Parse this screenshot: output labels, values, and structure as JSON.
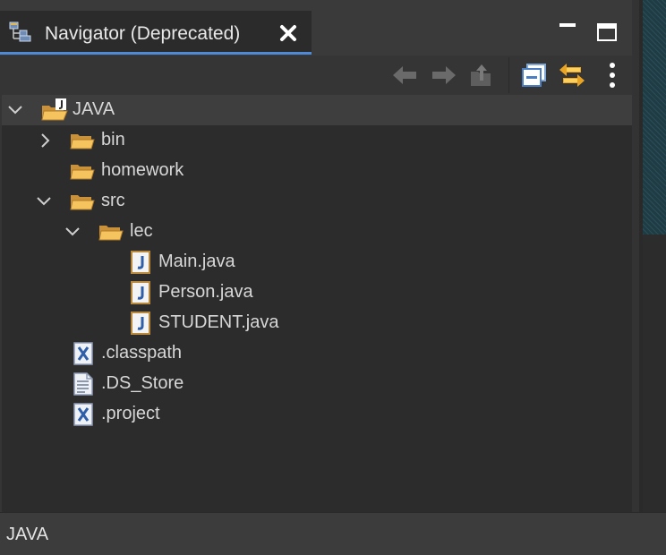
{
  "view": {
    "tab_title": "Navigator (Deprecated)",
    "tab_icon": "navigator-icon",
    "accent_color": "#4f8ad6"
  },
  "toolbar": {
    "buttons": [
      {
        "name": "back-button",
        "icon": "arrow-left-icon",
        "enabled": false
      },
      {
        "name": "forward-button",
        "icon": "arrow-right-icon",
        "enabled": false
      },
      {
        "name": "up-button",
        "icon": "up-folder-icon",
        "enabled": false
      },
      {
        "name": "collapse-all-button",
        "icon": "collapse-all-icon",
        "enabled": true
      },
      {
        "name": "link-with-editor-button",
        "icon": "link-arrows-icon",
        "enabled": true
      },
      {
        "name": "view-menu-button",
        "icon": "kebab-menu-icon",
        "enabled": true
      }
    ]
  },
  "tree": {
    "rows": [
      {
        "label": "JAVA",
        "icon": "project-folder-icon",
        "expanded": true,
        "selected": true
      },
      {
        "label": "bin",
        "icon": "folder-icon",
        "expanded": false
      },
      {
        "label": "homework",
        "icon": "folder-icon"
      },
      {
        "label": "src",
        "icon": "folder-icon",
        "expanded": true
      },
      {
        "label": "lec",
        "icon": "folder-icon",
        "expanded": true
      },
      {
        "label": "Main.java",
        "icon": "java-file-icon"
      },
      {
        "label": "Person.java",
        "icon": "java-file-icon"
      },
      {
        "label": "STUDENT.java",
        "icon": "java-file-icon"
      },
      {
        "label": ".classpath",
        "icon": "xml-file-icon"
      },
      {
        "label": ".DS_Store",
        "icon": "text-file-icon"
      },
      {
        "label": ".project",
        "icon": "xml-file-icon"
      }
    ]
  },
  "status": {
    "text": "JAVA"
  }
}
